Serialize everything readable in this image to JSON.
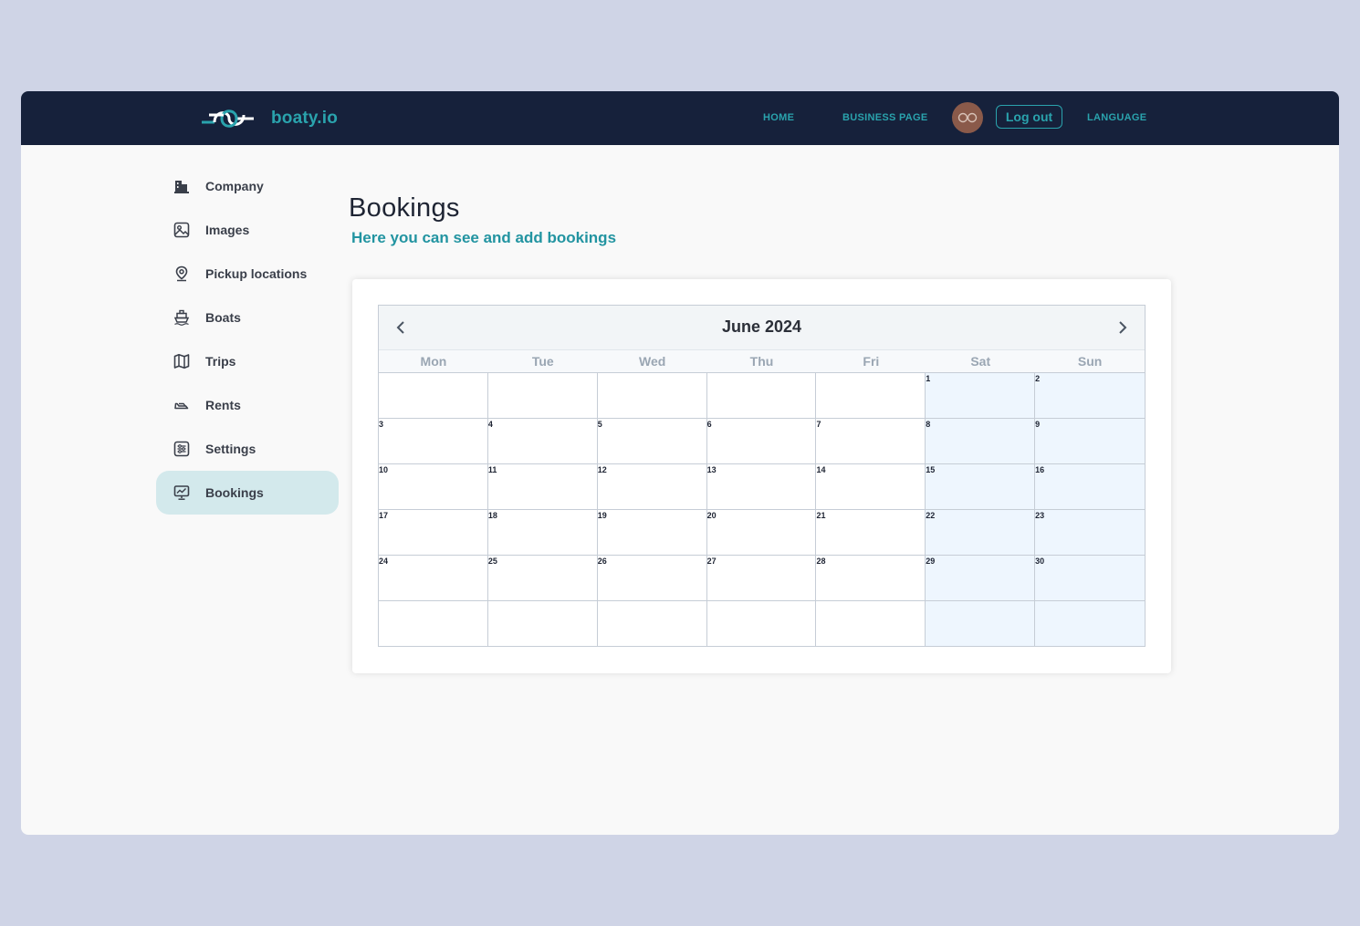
{
  "header": {
    "brand": "boaty.io",
    "nav": {
      "home": "HOME",
      "business_page": "BUSINESS PAGE",
      "logout": "Log out",
      "language": "LANGUAGE"
    }
  },
  "sidebar": {
    "items": [
      {
        "label": "Company",
        "icon": "building-icon"
      },
      {
        "label": "Images",
        "icon": "image-icon"
      },
      {
        "label": "Pickup locations",
        "icon": "map-pin-icon"
      },
      {
        "label": "Boats",
        "icon": "ship-icon"
      },
      {
        "label": "Trips",
        "icon": "map-icon"
      },
      {
        "label": "Rents",
        "icon": "boat-icon"
      },
      {
        "label": "Settings",
        "icon": "settings-list-icon"
      },
      {
        "label": "Bookings",
        "icon": "chart-board-icon",
        "active": true
      }
    ]
  },
  "main": {
    "title": "Bookings",
    "subtitle": "Here you can see and add bookings"
  },
  "calendar": {
    "month_title": "June 2024",
    "weekdays": [
      "Mon",
      "Tue",
      "Wed",
      "Thu",
      "Fri",
      "Sat",
      "Sun"
    ],
    "weeks": [
      [
        "",
        "",
        "",
        "",
        "",
        "1",
        "2"
      ],
      [
        "3",
        "4",
        "5",
        "6",
        "7",
        "8",
        "9"
      ],
      [
        "10",
        "11",
        "12",
        "13",
        "14",
        "15",
        "16"
      ],
      [
        "17",
        "18",
        "19",
        "20",
        "21",
        "22",
        "23"
      ],
      [
        "24",
        "25",
        "26",
        "27",
        "28",
        "29",
        "30"
      ],
      [
        "",
        "",
        "",
        "",
        "",
        "",
        ""
      ]
    ]
  },
  "colors": {
    "accent": "#2aa3ad",
    "topbar": "#16213b",
    "active_item": "#d3e9ec",
    "weekend": "#eef6fe"
  }
}
